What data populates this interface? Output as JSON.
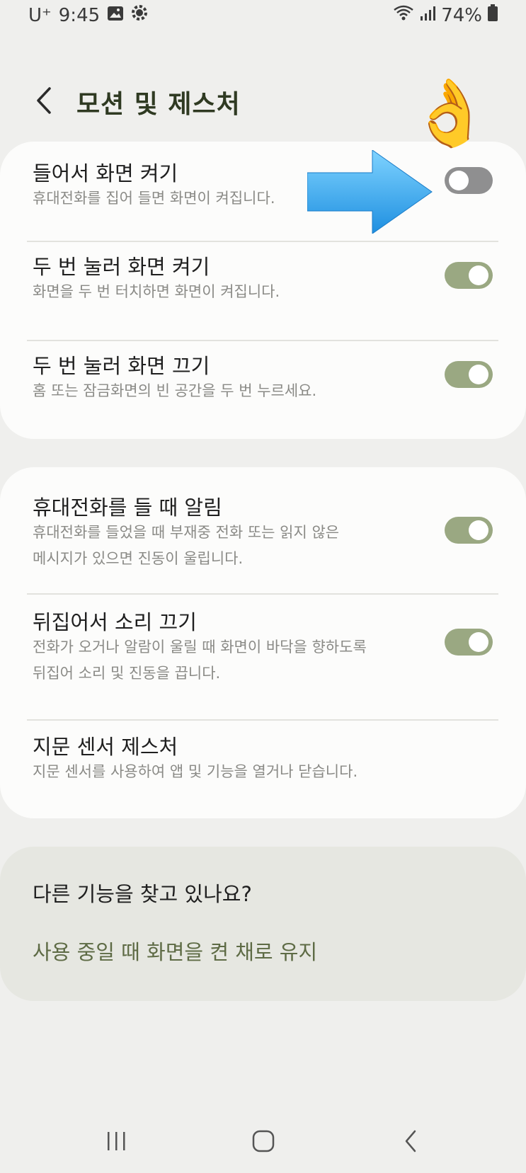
{
  "status_bar": {
    "carrier": "U⁺",
    "time": "9:45",
    "left_icons": [
      "gallery-icon",
      "brightness-settings-icon"
    ],
    "right_icons": [
      "wifi-icon",
      "signal-icon",
      "battery-icon"
    ],
    "battery": "74%"
  },
  "header": {
    "back_icon": "chevron-left-icon",
    "title": "모션 및 제스처"
  },
  "annotations": {
    "emoji": "👌",
    "arrow_color": "#3ab0f0"
  },
  "section1": {
    "items": [
      {
        "title": "들어서 화면 켜기",
        "description": "휴대전화를 집어 들면 화면이 켜집니다.",
        "toggle": "off"
      },
      {
        "title": "두 번 눌러 화면 켜기",
        "description": "화면을 두 번 터치하면 화면이 켜집니다.",
        "toggle": "on"
      },
      {
        "title": "두 번 눌러 화면 끄기",
        "description": "홈 또는 잠금화면의 빈 공간을 두 번 누르세요.",
        "toggle": "on"
      }
    ]
  },
  "section2": {
    "items": [
      {
        "title": "휴대전화를 들 때 알림",
        "description_line1": "휴대전화를 들었을 때 부재중 전화 또는 읽지 않은",
        "description_line2": "메시지가 있으면 진동이 울립니다.",
        "toggle": "on"
      },
      {
        "title": "뒤집어서 소리 끄기",
        "description_line1": "전화가 오거나 알람이 울릴 때 화면이 바닥을 향하도록",
        "description_line2": "뒤집어 소리 및 진동을 끕니다.",
        "toggle": "on"
      },
      {
        "title": "지문 센서 제스처",
        "description": "지문 센서를 사용하여 앱 및 기능을 열거나 닫습니다."
      }
    ]
  },
  "section3": {
    "title": "다른 기능을 찾고 있나요?",
    "link": "사용 중일 때 화면을 켠 채로 유지"
  },
  "nav_bar": {
    "icons": [
      "recent-apps-icon",
      "home-icon",
      "back-icon"
    ]
  },
  "colors": {
    "toggle_on": "#9aa882",
    "toggle_off": "#8f8f90",
    "title_accent": "#2f3a22",
    "link_accent": "#5e6b45"
  }
}
